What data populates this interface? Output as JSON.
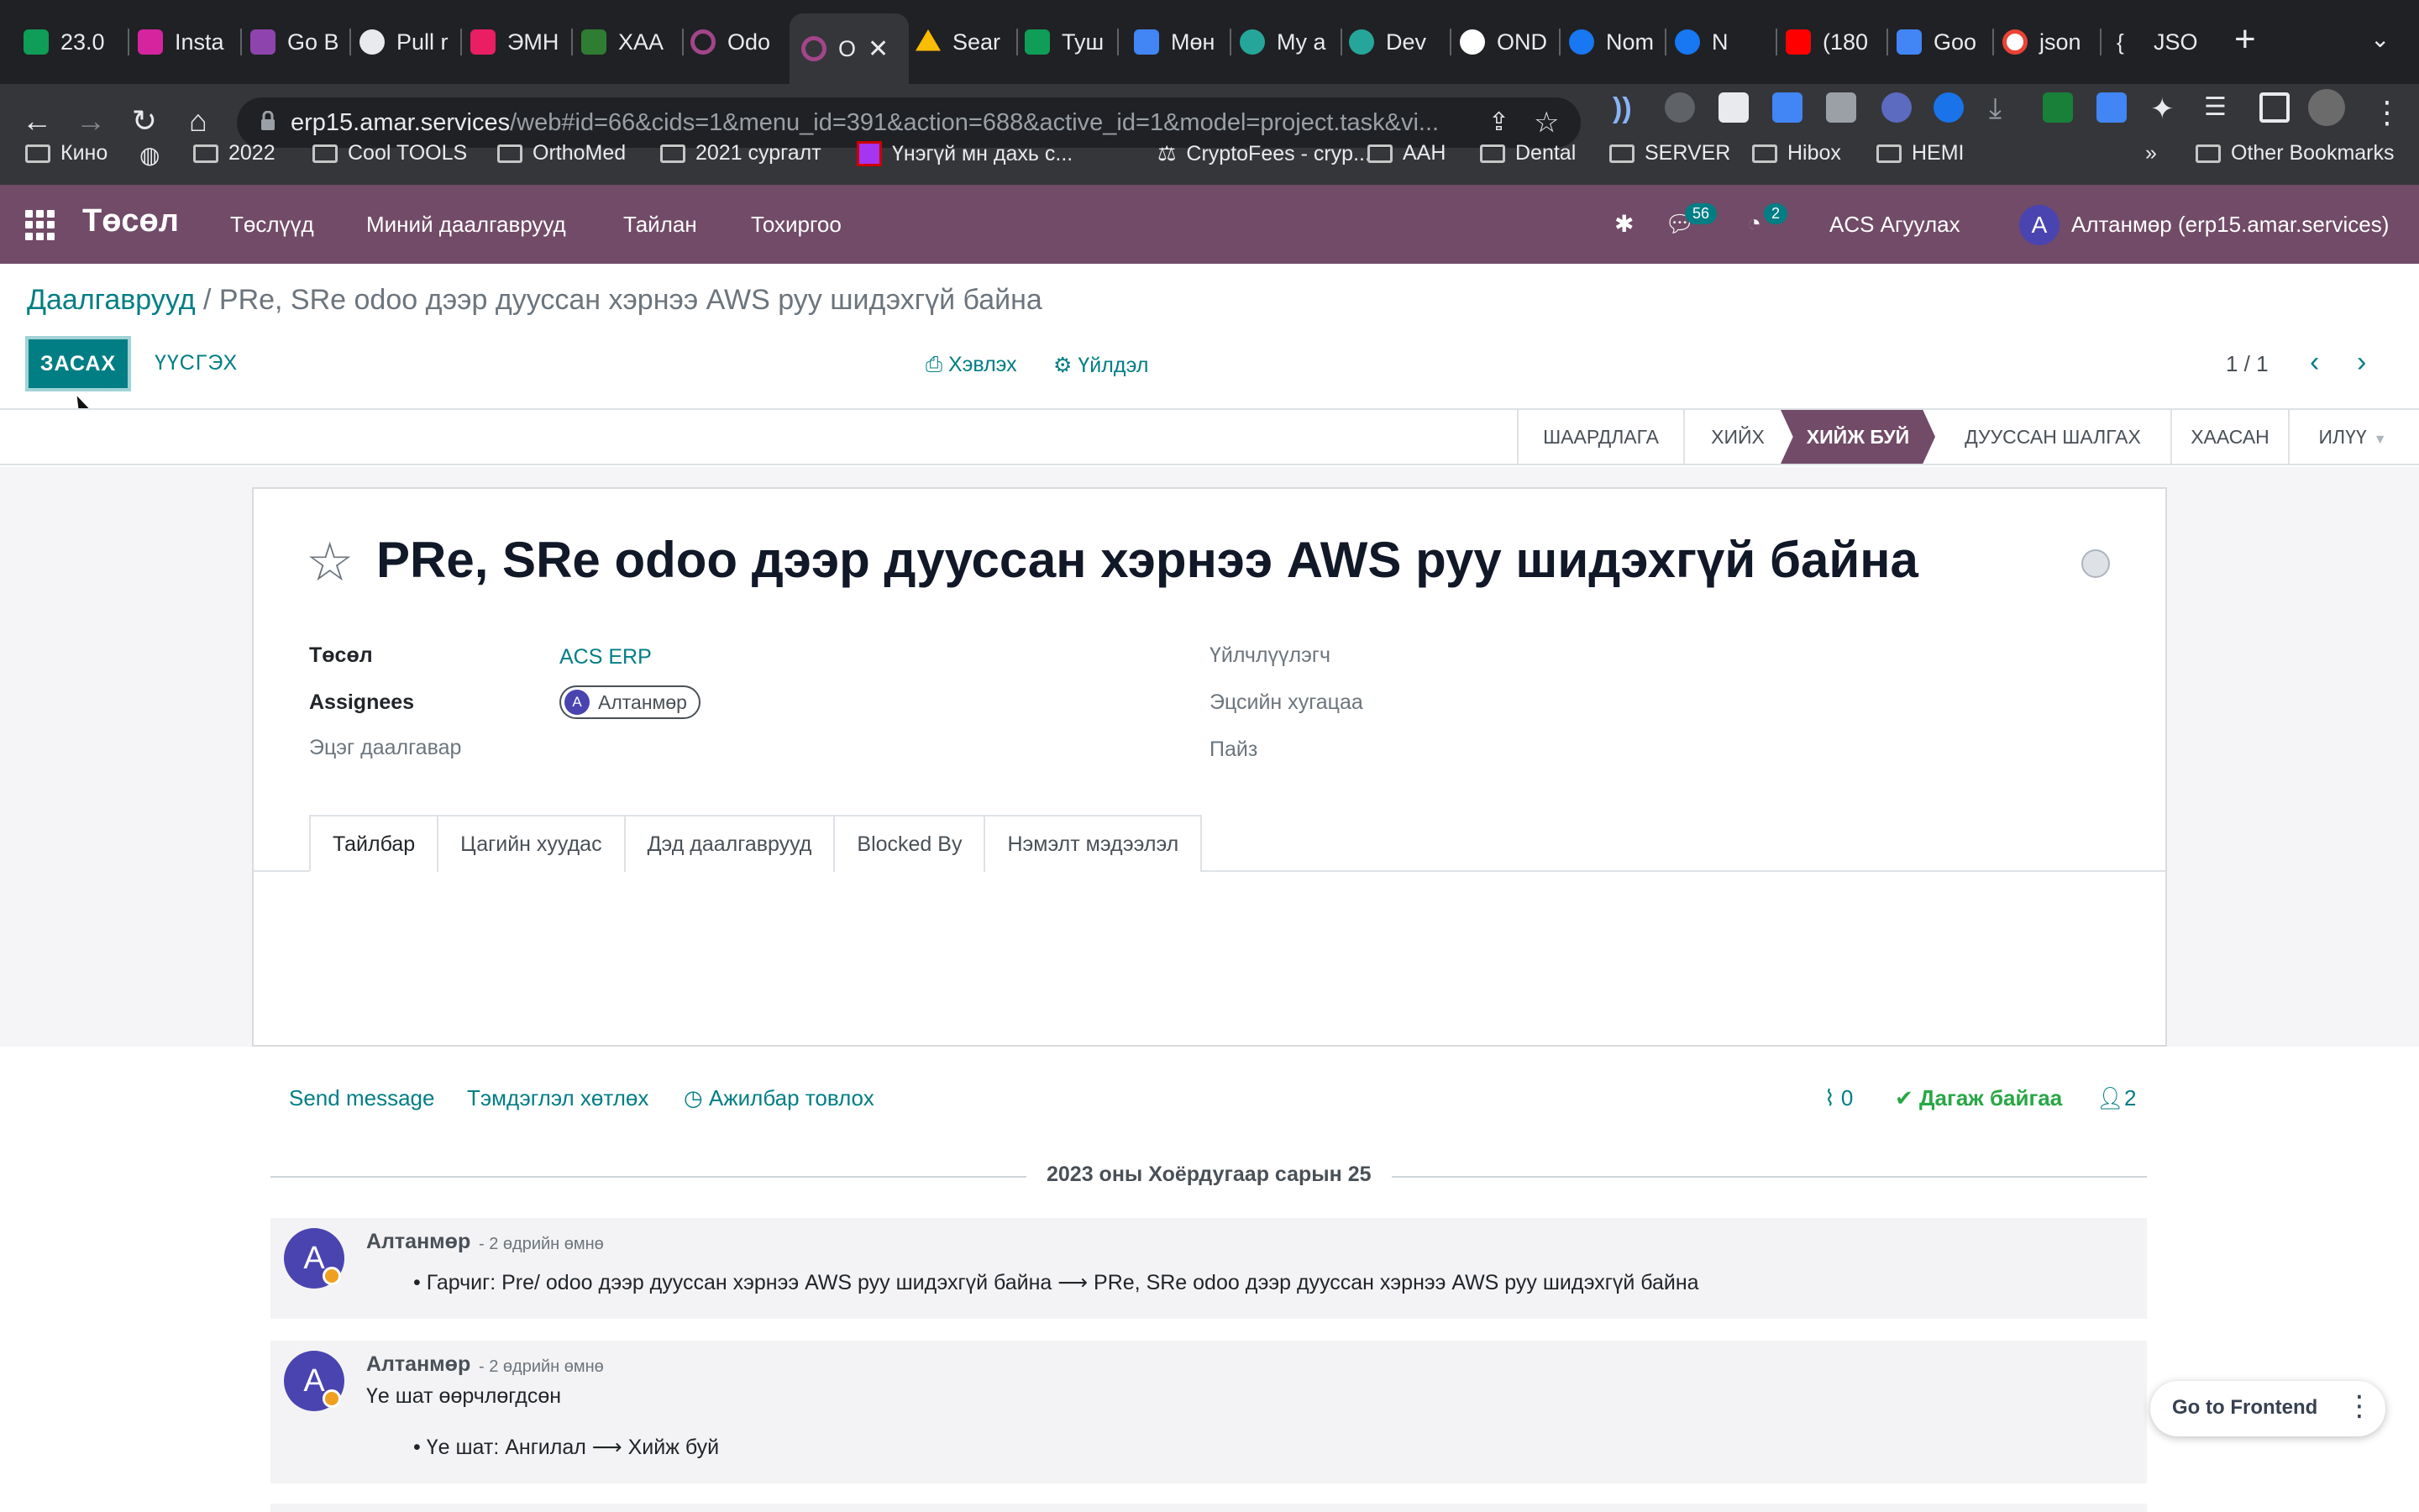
{
  "browser": {
    "tabs": [
      {
        "label": "23.0",
        "icon": "sheets-icon",
        "color": "#0f9d58"
      },
      {
        "label": "Insta",
        "icon": "instagram-icon",
        "color": "#d6249f"
      },
      {
        "label": "Go B",
        "icon": "extension-icon",
        "color": "#8e44ad"
      },
      {
        "label": "Pull r",
        "icon": "github-icon",
        "color": "#e8eaed"
      },
      {
        "label": "ЭМН",
        "icon": "app-icon",
        "color": "#e91e63"
      },
      {
        "label": "ХАА",
        "icon": "app-icon",
        "color": "#2e7d32"
      },
      {
        "label": "Odo",
        "icon": "odoo-icon",
        "color": "#a24689"
      },
      {
        "label": "O",
        "icon": "odoo-icon",
        "color": "#a24689"
      },
      {
        "label": "Sear",
        "icon": "drive-icon",
        "color": "#fbbc04"
      },
      {
        "label": "Туш",
        "icon": "sheets-icon",
        "color": "#0f9d58"
      },
      {
        "label": "Мөн",
        "icon": "docs-icon",
        "color": "#4285f4"
      },
      {
        "label": "My a",
        "icon": "eye-icon",
        "color": "#26a69a"
      },
      {
        "label": "Dev",
        "icon": "eye-icon",
        "color": "#26a69a"
      },
      {
        "label": "OND",
        "icon": "app-icon",
        "color": "#ffffff"
      },
      {
        "label": "Nom",
        "icon": "facebook-icon",
        "color": "#1877f2"
      },
      {
        "label": "N",
        "icon": "facebook-icon",
        "color": "#1877f2"
      },
      {
        "label": "(180",
        "icon": "youtube-icon",
        "color": "#ff0000"
      },
      {
        "label": "Goo",
        "icon": "translate-icon",
        "color": "#4285f4"
      },
      {
        "label": "json",
        "icon": "google-icon",
        "color": "#ffffff"
      },
      {
        "label": "JSO",
        "icon": "json-icon",
        "color": "#e8eaed"
      }
    ],
    "url_host": "erp15.amar.services",
    "url_path": "/web#id=66&cids=1&menu_id=391&action=688&active_id=1&model=project.task&vi...",
    "bookmarks": [
      "Кино",
      "2022",
      "Cool TOOLS",
      "OrthoMed",
      "2021 сургалт",
      "Үнэгүй мн дахь с...",
      "CryptoFees - cryp...",
      "AAH",
      "Dental",
      "SERVER",
      "Hibox",
      "HEMI"
    ],
    "bookmarks_more": "»",
    "other_bookmarks": "Other Bookmarks"
  },
  "app": {
    "brand": "Төсөл",
    "menu": [
      "Төслүүд",
      "Миний даалгаврууд",
      "Тайлан",
      "Тохиргоо"
    ],
    "messages_count": "56",
    "activities_count": "2",
    "company": "ACS Агуулах",
    "user_initial": "A",
    "user_name": "Алтанмөр (erp15.amar.services)",
    "accent": "#714b67",
    "primary": "#017e84"
  },
  "control": {
    "breadcrumb_parent": "Даалгаврууд",
    "breadcrumb_sep": " / ",
    "breadcrumb_current": "PRe, SRe odoo дээр дууссан хэрнээ AWS руу шидэхгүй байна",
    "edit_label": "ЗАСАХ",
    "create_label": "ҮҮСГЭХ",
    "print_label": "Хэвлэх",
    "action_label": "Үйлдэл",
    "pager": "1 / 1"
  },
  "stages": {
    "items": [
      "ШААРДЛАГА",
      "ХИЙХ",
      "ХИЙЖ БУЙ",
      "ДУУССАН ШАЛГАХ",
      "ХААСАН",
      "ИЛҮҮ"
    ],
    "active": "ХИЙЖ БУЙ"
  },
  "task": {
    "title": "PRe, SRe odoo дээр дууссан хэрнээ AWS руу шидэхгүй байна",
    "fields": {
      "project_label": "Төсөл",
      "project_value": "ACS ERP",
      "assignees_label": "Assignees",
      "assignee_initial": "A",
      "assignee_name": "Алтанмөр",
      "parent_label": "Эцэг даалгавар",
      "customer_label": "Үйлчлүүлэгч",
      "deadline_label": "Эцсийн хугацаа",
      "tags_label": "Пайз"
    },
    "tabs": [
      "Тайлбар",
      "Цагийн хуудас",
      "Дэд даалгаврууд",
      "Blocked By",
      "Нэмэлт мэдээлэл"
    ],
    "active_tab": "Тайлбар"
  },
  "chatter": {
    "send_message": "Send message",
    "log_note": "Тэмдэглэл хөтлөх",
    "schedule_activity": "Ажилбар товлох",
    "attachments_count": "0",
    "following": "Дагаж байгаа",
    "followers_count": "2",
    "date_separator": "2023 оны Хоёрдугаар сарын 25",
    "messages": [
      {
        "author": "Алтанмөр",
        "ago": "- 2 өдрийн өмнө",
        "initial": "A",
        "body": "",
        "change": "Гарчиг: Pre/ odoo дээр дууссан хэрнээ AWS руу шидэхгүй байна ⟶ PRe, SRe odoo дээр дууссан хэрнээ AWS руу шидэхгүй байна"
      },
      {
        "author": "Алтанмөр",
        "ago": "- 2 өдрийн өмнө",
        "initial": "A",
        "body": "Үе шат өөрчлөгдсөн",
        "change": "Үе шат: Ангилал ⟶ Хийж буй"
      }
    ]
  },
  "floating": {
    "label": "Go to Frontend",
    "more": "⋮"
  }
}
